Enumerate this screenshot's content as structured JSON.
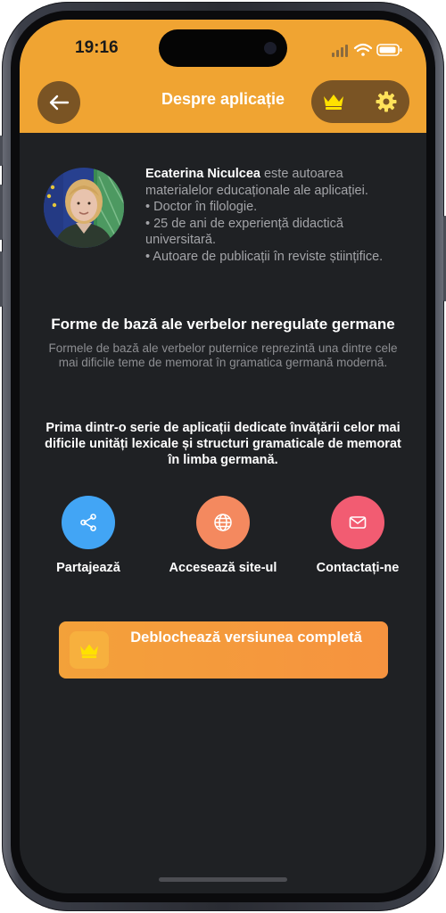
{
  "status_bar": {
    "time": "19:16"
  },
  "header": {
    "title": "Despre aplicație"
  },
  "author": {
    "name": "Ecaterina Niculcea",
    "intro": " este autoarea materialelor educaționale ale aplicației.",
    "bullets": [
      "• Doctor în filologie.",
      "• 25 de ani de experiență didactică universitară.",
      "• Autoare de publicații în reviste științifice."
    ]
  },
  "app": {
    "title": "Forme de bază ale verbelor neregulate germane",
    "description": "Formele de bază ale verbelor puternice reprezintă una dintre cele mai dificile teme de memorat în gramatica germană modernă.",
    "series_text": "Prima dintr-o serie de aplicații dedicate învățării celor mai dificile unități lexicale și structuri gramaticale de memorat în limba germană."
  },
  "actions": [
    {
      "label": "Partajează",
      "icon": "share-icon",
      "color": "#42a5f5"
    },
    {
      "label": "Accesează site-ul",
      "icon": "globe-icon",
      "color": "#f4895f"
    },
    {
      "label": "Contactați-ne",
      "icon": "mail-icon",
      "color": "#f25c72"
    }
  ],
  "unlock": {
    "label": "Deblochează versiunea completă",
    "icon": "crown-icon"
  },
  "colors": {
    "header": "#f0a432",
    "background": "#1f2124",
    "header_button": "#7a5424",
    "crown": "#ffe100"
  }
}
